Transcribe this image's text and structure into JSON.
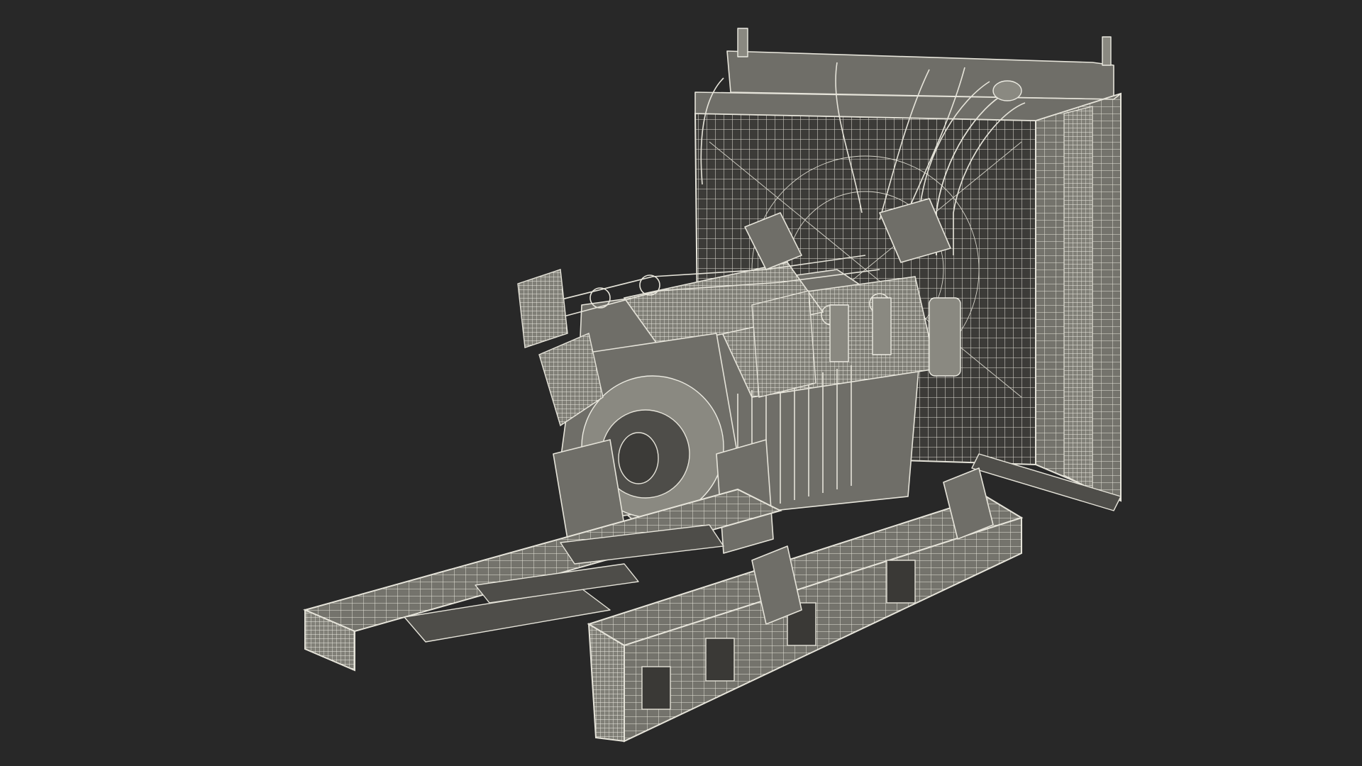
{
  "scene": {
    "background_color": "#282828",
    "wire_color": "#e6e4da",
    "surface_color": "#6f6e68"
  }
}
